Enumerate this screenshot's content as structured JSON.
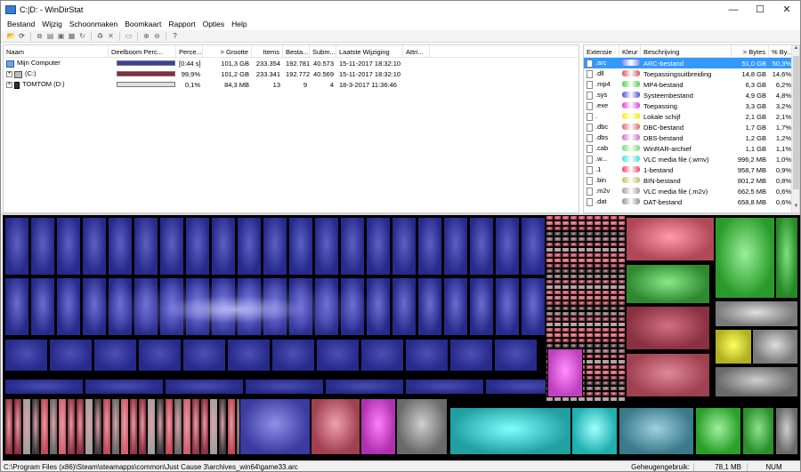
{
  "window": {
    "title": "C:|D: - WinDirStat",
    "minimize": "—",
    "maximize": "☐",
    "close": "✕"
  },
  "menu": [
    "Bestand",
    "Wijzig",
    "Schoonmaken",
    "Boomkaart",
    "Rapport",
    "Opties",
    "Help"
  ],
  "toolbar": [
    {
      "icon": "open-folder-icon",
      "glyph": "📂",
      "active": true
    },
    {
      "icon": "refresh-icon",
      "glyph": "⟳",
      "active": true
    },
    {
      "icon": "sep"
    },
    {
      "icon": "copy-icon",
      "glyph": "⧉",
      "active": false
    },
    {
      "icon": "copy-path-icon",
      "glyph": "▤",
      "active": false
    },
    {
      "icon": "cmd-icon",
      "glyph": "▣",
      "active": false
    },
    {
      "icon": "explorer-icon",
      "glyph": "▦",
      "active": false
    },
    {
      "icon": "refresh-selected-icon",
      "glyph": "↻",
      "active": false
    },
    {
      "icon": "sep"
    },
    {
      "icon": "recycle-icon",
      "glyph": "♻",
      "active": false
    },
    {
      "icon": "delete-icon",
      "glyph": "✕",
      "active": false
    },
    {
      "icon": "sep"
    },
    {
      "icon": "new-folder-icon",
      "glyph": "▭",
      "active": false
    },
    {
      "icon": "sep"
    },
    {
      "icon": "zoom-in-icon",
      "glyph": "⊕",
      "active": false
    },
    {
      "icon": "zoom-out-icon",
      "glyph": "⊖",
      "active": false
    },
    {
      "icon": "sep"
    },
    {
      "icon": "help-icon",
      "glyph": "?",
      "active": true
    }
  ],
  "tree": {
    "columns": [
      "Naam",
      "Deelboom Perc...",
      "Perce...",
      "> Grootte",
      "Items",
      "Besta...",
      "Subm...",
      "Laatste Wijziging",
      "Attri..."
    ],
    "rows": [
      {
        "name": "Mijn Computer",
        "icon": "computer-icon",
        "expand": "",
        "pct_label": "[0:44 s]",
        "bar_fraction": 1.0,
        "bar_color": "#3b3f9e",
        "size": "101,3 GB",
        "items": "233.354",
        "files": "192.781",
        "subdirs": "40.573",
        "modified": "15-11-2017  18:32:10",
        "attr": ""
      },
      {
        "name": "(C:)",
        "icon": "drive-icon",
        "expand": "⊞",
        "pct_label": "99,9%",
        "bar_fraction": 0.999,
        "bar_color": "#8a2c3c",
        "size": "101,2 GB",
        "items": "233.341",
        "files": "192.772",
        "subdirs": "40.569",
        "modified": "15-11-2017  18:32:10",
        "attr": ""
      },
      {
        "name": "TOMTOM (D:)",
        "icon": "usb-drive-icon",
        "expand": "⊞",
        "pct_label": "0,1%",
        "bar_fraction": 0.001,
        "bar_color": "#8a2c3c",
        "size": "84,3 MB",
        "items": "13",
        "files": "9",
        "subdirs": "4",
        "modified": "18-3-2017  11:36:46",
        "attr": ""
      }
    ]
  },
  "extensions": {
    "columns": [
      "Extensie",
      "Kleur",
      "Beschrijving",
      "> Bytes",
      "% By..."
    ],
    "rows": [
      {
        "ext": ".arc",
        "color": "#8a8cf0",
        "desc": "ARC-bestand",
        "bytes": "51,0 GB",
        "pct": "50,3%",
        "selected": true
      },
      {
        "ext": ".dll",
        "color": "#e05060",
        "desc": "Toepassingsuitbreiding",
        "bytes": "14,8 GB",
        "pct": "14,6%",
        "selected": false
      },
      {
        "ext": ".mp4",
        "color": "#50d050",
        "desc": "MP4-bestand",
        "bytes": "6,3 GB",
        "pct": "6,2%",
        "selected": false
      },
      {
        "ext": ".sys",
        "color": "#5050e0",
        "desc": "Systeembestand",
        "bytes": "4,9 GB",
        "pct": "4,8%",
        "selected": false
      },
      {
        "ext": ".exe",
        "color": "#e040e0",
        "desc": "Toepassing",
        "bytes": "3,3 GB",
        "pct": "3,2%",
        "selected": false
      },
      {
        "ext": ".",
        "color": "#f0f000",
        "desc": "Lokale schijf",
        "bytes": "2,1 GB",
        "pct": "2,1%",
        "selected": false
      },
      {
        "ext": ".dbc",
        "color": "#e06868",
        "desc": "DBC-bestand",
        "bytes": "1,7 GB",
        "pct": "1,7%",
        "selected": false
      },
      {
        "ext": ".dbs",
        "color": "#d070d0",
        "desc": "DBS-bestand",
        "bytes": "1,2 GB",
        "pct": "1,2%",
        "selected": false
      },
      {
        "ext": ".cab",
        "color": "#70e070",
        "desc": "WinRAR-archief",
        "bytes": "1,1 GB",
        "pct": "1,1%",
        "selected": false
      },
      {
        "ext": ".w...",
        "color": "#40e0e0",
        "desc": "VLC media file (.wmv)",
        "bytes": "996,2 MB",
        "pct": "1,0%",
        "selected": false
      },
      {
        "ext": ".1",
        "color": "#f04070",
        "desc": "1-bestand",
        "bytes": "958,7 MB",
        "pct": "0,9%",
        "selected": false
      },
      {
        "ext": ".bin",
        "color": "#c0c060",
        "desc": "BIN-bestand",
        "bytes": "801,2 MB",
        "pct": "0,8%",
        "selected": false
      },
      {
        "ext": ".m2v",
        "color": "#a0a0a0",
        "desc": "VLC media file (.m2v)",
        "bytes": "662,5 MB",
        "pct": "0,6%",
        "selected": false
      },
      {
        "ext": ".dat",
        "color": "#909090",
        "desc": "DAT-bestand",
        "bytes": "658,8 MB",
        "pct": "0,6%",
        "selected": false
      }
    ]
  },
  "status": {
    "path": "C:\\Program Files (x86)\\Steam\\steamapps\\common\\Just Cause 3\\archives_win64\\game33.arc",
    "mem_label": "Geheugengebruik:",
    "mem_value": "78,1 MB",
    "num": "NUM"
  }
}
